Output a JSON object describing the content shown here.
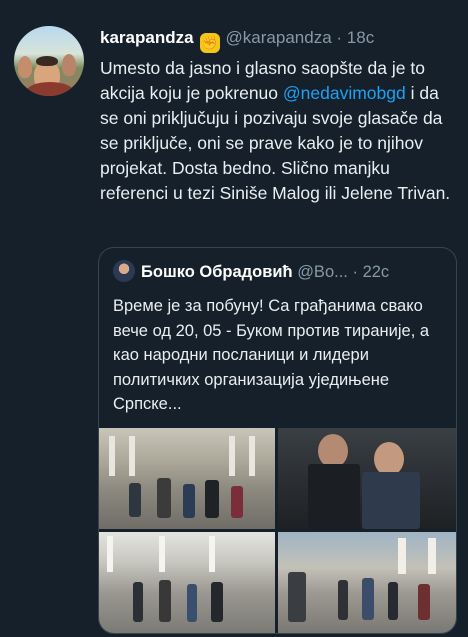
{
  "tweet": {
    "display_name": "karapandza",
    "emoji": "✊",
    "handle": "@karapandza",
    "separator": "·",
    "time": "18c",
    "text_before": "Umesto da jasno i glasno saopšte da je to akcija koju je pokrenuo ",
    "mention": "@nedavimobgd",
    "text_after": " i da se oni priključuju i pozivaju svoje glasače da se priključe, oni se prave kako je to njihov projekat. Dosta bedno. Slično manjku referenci u tezi Siniše Malog ili Jelene Trivan."
  },
  "quoted_tweet": {
    "display_name": "Бошко Обрадовић",
    "handle": "@Bo...",
    "separator": "·",
    "time": "22c",
    "text": "Време је за побуну! Са грађанима свако вече од 20, 05 - Буком против тираније, а као народни посланици и лидери политичких организација уједињене Српске..."
  },
  "colors": {
    "background": "#15202b",
    "link": "#1da1f2",
    "muted": "#8899a6",
    "border": "#38444d"
  }
}
